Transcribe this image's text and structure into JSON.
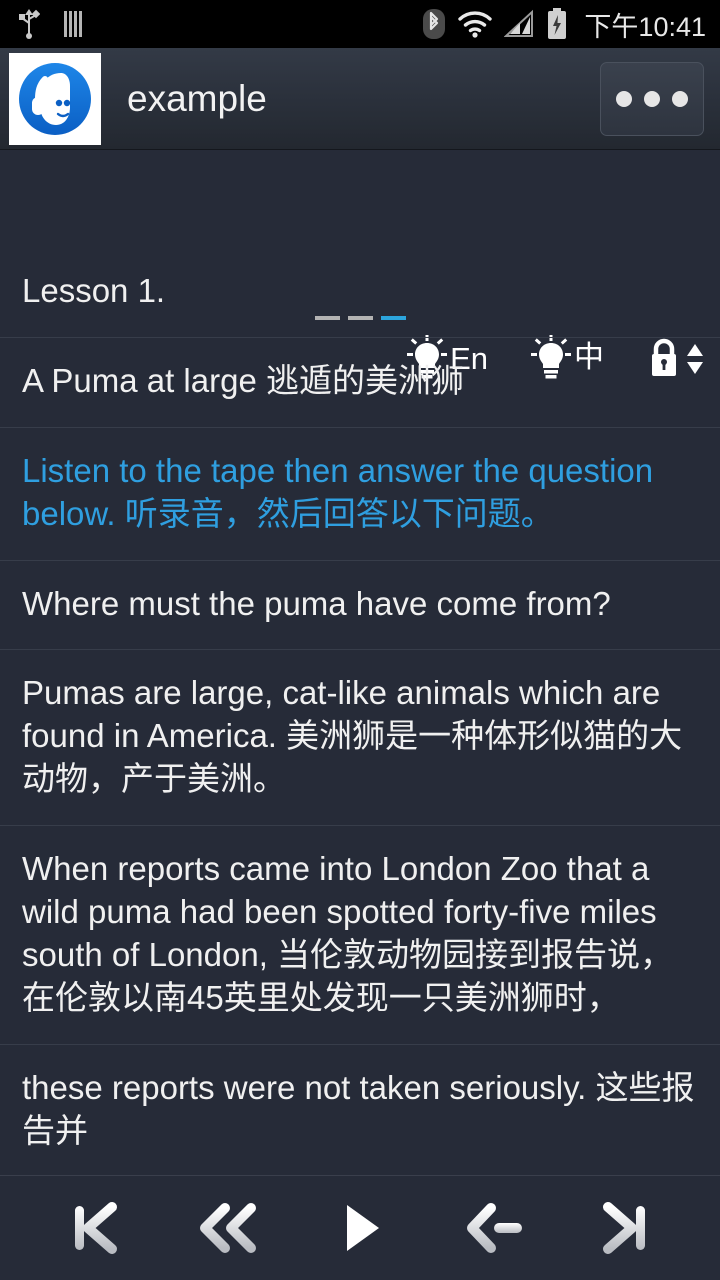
{
  "status_bar": {
    "time": "下午10:41",
    "icons": [
      "usb-icon",
      "vibrate-bars-icon",
      "bluetooth-icon",
      "wifi-icon",
      "cellular-signal-icon",
      "battery-charging-icon"
    ]
  },
  "app_bar": {
    "icon": "headphones-avatar-app-icon",
    "title": "example",
    "overflow_label": "overflow-menu"
  },
  "toolbar": {
    "page_indicator": {
      "total": 3,
      "active_index": 2
    },
    "buttons": [
      {
        "name": "hint-english-button",
        "icon": "lightbulb-icon",
        "label": "En"
      },
      {
        "name": "hint-chinese-button",
        "icon": "lightbulb-icon",
        "label": "中"
      },
      {
        "name": "scroll-lock-button",
        "icon": "lock-icon",
        "label": ""
      }
    ]
  },
  "content": {
    "rows": [
      {
        "text": "Lesson 1.",
        "highlight": false
      },
      {
        "text": "A Puma at large  逃遁的美洲狮",
        "highlight": false
      },
      {
        "text": "Listen to the tape then answer the question below.  听录音，然后回答以下问题。",
        "highlight": true
      },
      {
        "text": "Where must the puma have come from?",
        "highlight": false
      },
      {
        "text": "Pumas are large, cat-like animals which are found in America.  美洲狮是一种体形似猫的大动物，产于美洲。",
        "highlight": false
      },
      {
        "text": "When reports came into London Zoo that a wild puma had been spotted forty-five miles south of London,  当伦敦动物园接到报告说，在伦敦以南45英里处发现一只美洲狮时，",
        "highlight": false
      },
      {
        "text": "these reports were not taken seriously.  这些报告并",
        "highlight": false
      }
    ]
  },
  "player": {
    "buttons": [
      {
        "name": "skip-to-start-button",
        "icon": "skip-previous-icon"
      },
      {
        "name": "rewind-button",
        "icon": "rewind-double-arrow-icon"
      },
      {
        "name": "play-button",
        "icon": "play-icon"
      },
      {
        "name": "repeat-back-button",
        "icon": "arrow-left-icon"
      },
      {
        "name": "skip-to-end-button",
        "icon": "skip-next-icon"
      }
    ]
  },
  "colors": {
    "background": "#262b38",
    "divider": "#373d4a",
    "accent_blue": "#2f9fe0",
    "indicator_active": "#2ca5dd",
    "text": "#f0f0f0",
    "statusbar": "#000000"
  }
}
